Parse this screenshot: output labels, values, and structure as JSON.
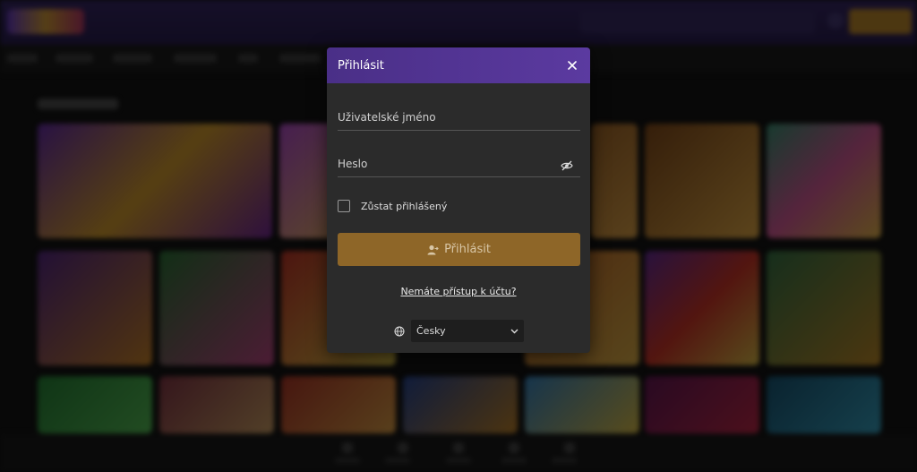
{
  "modal": {
    "title": "Přihlásit",
    "username_placeholder": "Uživatelské jméno",
    "password_placeholder": "Heslo",
    "remember_label": "Zůstat přihlášený",
    "submit_label": "Přihlásit",
    "no_access_link": "Nemáte přístup k účtu?",
    "language_selected": "Česky"
  },
  "icons": {
    "close": "close-icon",
    "eye": "eye-slash-icon",
    "submit": "user-login-icon",
    "globe": "globe-icon",
    "dropdown": "chevron-down-icon"
  },
  "colors": {
    "header_accent": "#5b3aa0",
    "submit_button": "#8e6628",
    "modal_background": "#2b2b2b"
  }
}
